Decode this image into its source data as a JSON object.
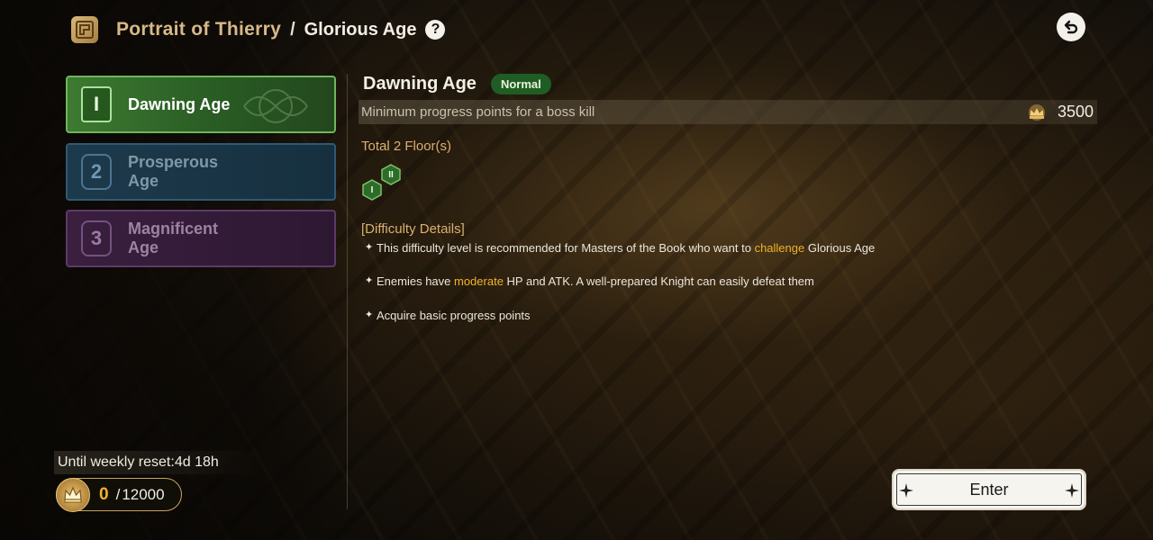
{
  "header": {
    "title": "Portrait of Thierry",
    "separator": "/",
    "subtitle": "Glorious Age",
    "help_label": "?"
  },
  "tiers": [
    {
      "number": "I",
      "label": "Dawning Age",
      "state": "selected",
      "color": "#3e7a32"
    },
    {
      "number": "2",
      "label": "Prosperous Age",
      "state": "locked",
      "color": "#1d3a4c"
    },
    {
      "number": "3",
      "label": "Magnificent Age",
      "state": "locked",
      "color": "#3a1f3f"
    }
  ],
  "detail": {
    "title": "Dawning Age",
    "badge": "Normal",
    "progress_label": "Minimum progress points for a boss kill",
    "progress_value": "3500",
    "floors_label": "Total 2 Floor(s)",
    "floor_icons": [
      "I",
      "II"
    ],
    "details_title": "[Difficulty Details]",
    "lines": [
      {
        "pre": "This difficulty level is recommended for Masters of the Book who want to ",
        "hl": "challenge",
        "post": " Glorious Age"
      },
      {
        "pre": "Enemies have ",
        "hl": "moderate",
        "post": " HP and ATK. A well-prepared Knight can easily defeat them"
      },
      {
        "pre": "Acquire basic progress points",
        "hl": "",
        "post": ""
      }
    ]
  },
  "footer": {
    "reset_text": "Until weekly reset:4d 18h",
    "points_current": "0",
    "points_sep": "/",
    "points_max": "12000",
    "enter_label": "Enter"
  },
  "colors": {
    "accent_gold": "#f0b428",
    "label_gold": "#d9b070",
    "normal_badge": "#1f5d25"
  }
}
